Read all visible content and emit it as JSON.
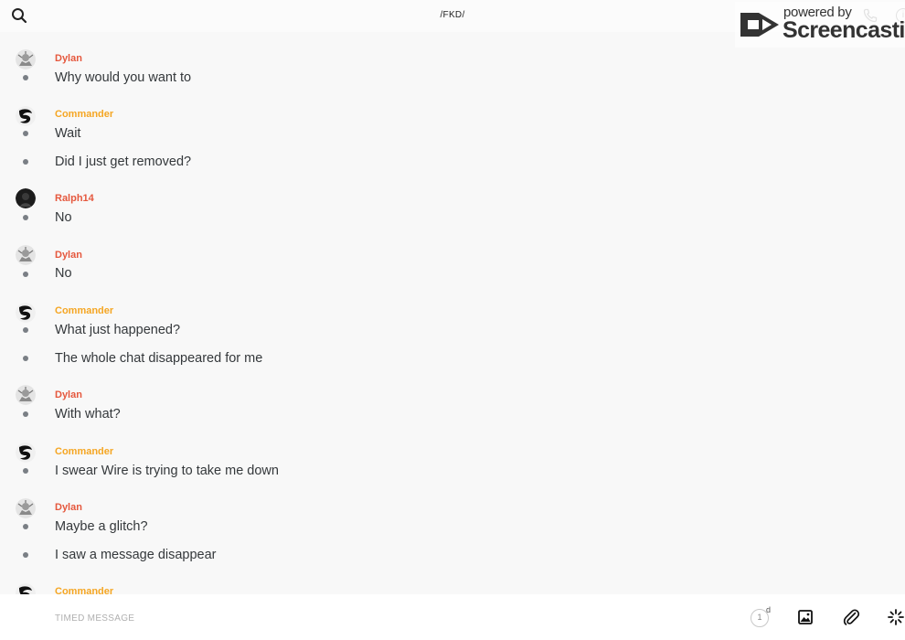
{
  "header": {
    "title": "/FKD/",
    "search_icon": "search-icon",
    "call_icon": "phone-icon",
    "info_label": "i"
  },
  "watermark": {
    "powered": "powered by",
    "brand": "Screencastify"
  },
  "colors": {
    "dylan": "#e5583e",
    "commander": "#f5a623",
    "ralph": "#e5583e",
    "text": "#34383b",
    "dot": "#7a7f85"
  },
  "messages": [
    {
      "sender": "Dylan",
      "lines": [
        "Why would you want to"
      ]
    },
    {
      "sender": "Commander",
      "lines": [
        "Wait",
        "Did I just get removed?"
      ]
    },
    {
      "sender": "Ralph14",
      "lines": [
        "No"
      ]
    },
    {
      "sender": "Dylan",
      "lines": [
        "No"
      ]
    },
    {
      "sender": "Commander",
      "lines": [
        "What just happened?",
        "The whole chat disappeared for me"
      ]
    },
    {
      "sender": "Dylan",
      "lines": [
        "With what?"
      ]
    },
    {
      "sender": "Commander",
      "lines": [
        "I swear Wire is trying to take me down"
      ]
    },
    {
      "sender": "Dylan",
      "lines": [
        "Maybe a glitch?",
        "I saw a message disappear"
      ]
    },
    {
      "sender": "Commander",
      "lines": []
    }
  ],
  "input": {
    "placeholder": "TIMED MESSAGE",
    "timer_value": "1",
    "timer_unit": "d"
  }
}
